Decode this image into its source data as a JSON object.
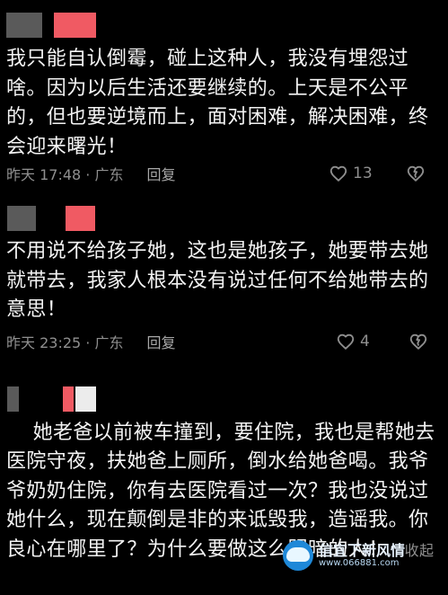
{
  "comments": [
    {
      "text": "我只能自认倒霉，碰上这种人，我没有埋怨过啥。因为以后生活还要继续的。上天是不公平的，但也要逆境而上，面对困难，解决困难，终会迎来曙光！",
      "meta": "昨天 17:48 · 广东",
      "reply": "回复",
      "likes": "13",
      "like_icon": "heart-outline-icon",
      "dislike_icon": "broken-heart-outline-icon"
    },
    {
      "text": "不用说不给孩子她，这也是她孩子，她要带去她就带去，我家人根本没有说过任何不给她带去的意思！",
      "meta": "昨天 23:25 · 广东",
      "reply": "回复",
      "likes": "4",
      "like_icon": "heart-outline-icon",
      "dislike_icon": "broken-heart-outline-icon"
    },
    {
      "text": "她老爸以前被车撞到，要住院，我也是帮她去医院守夜，扶她爸上厕所，倒水给她爸喝。我爷爷奶奶住院，你有去医院看过一次？我也没说过她什么，现在颠倒是非的来诋毁我，造谣我。你良心在哪里了？为什么要做这么阴暗的人！",
      "collapse": "收起"
    }
  ],
  "watermark": {
    "title": "信宜下新风情",
    "url": "www.066881.com"
  },
  "colors": {
    "background": "#000000",
    "text": "#f3f3f3",
    "muted": "#8f8f8f",
    "pink": "#f05a63"
  }
}
